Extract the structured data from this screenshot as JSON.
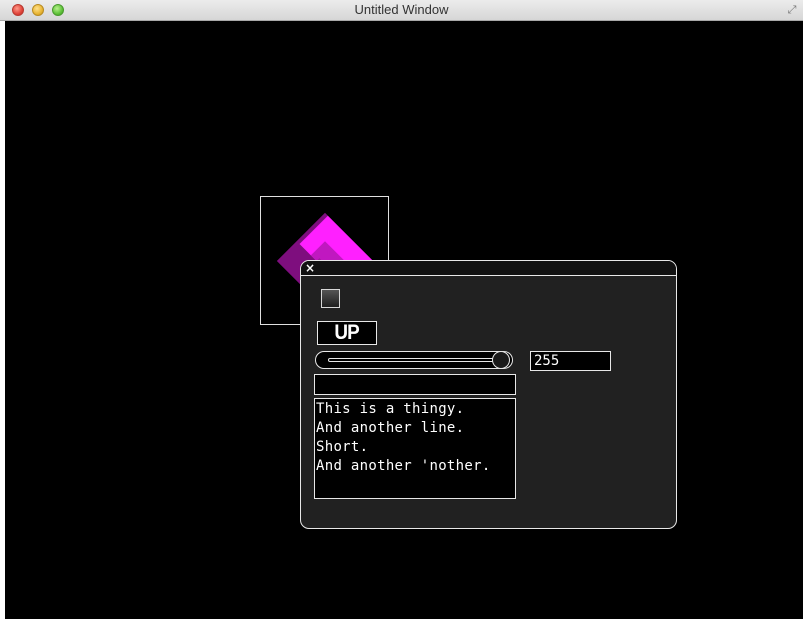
{
  "window": {
    "title": "Untitled Window"
  },
  "icons": {
    "close": "close-icon",
    "minimize": "minimize-icon",
    "maximize": "maximize-icon",
    "fullscreen": "fullscreen-icon",
    "panel_close": "close-icon"
  },
  "panel": {
    "close_glyph": "×",
    "checkbox_checked": false,
    "up_button_label": "UP",
    "slider_value": 255,
    "slider_max": 255,
    "value_field": "255",
    "text_input_value": "",
    "text_area_lines": [
      "This is a thingy.",
      "And another line.",
      "Short.",
      "And another 'nother."
    ]
  },
  "colors": {
    "canvas_bg": "#000000",
    "panel_bg": "#212121",
    "outline": "#e8e8e8",
    "magenta_light": "#ff20ff",
    "magenta_dark": "#7a0a7a"
  }
}
